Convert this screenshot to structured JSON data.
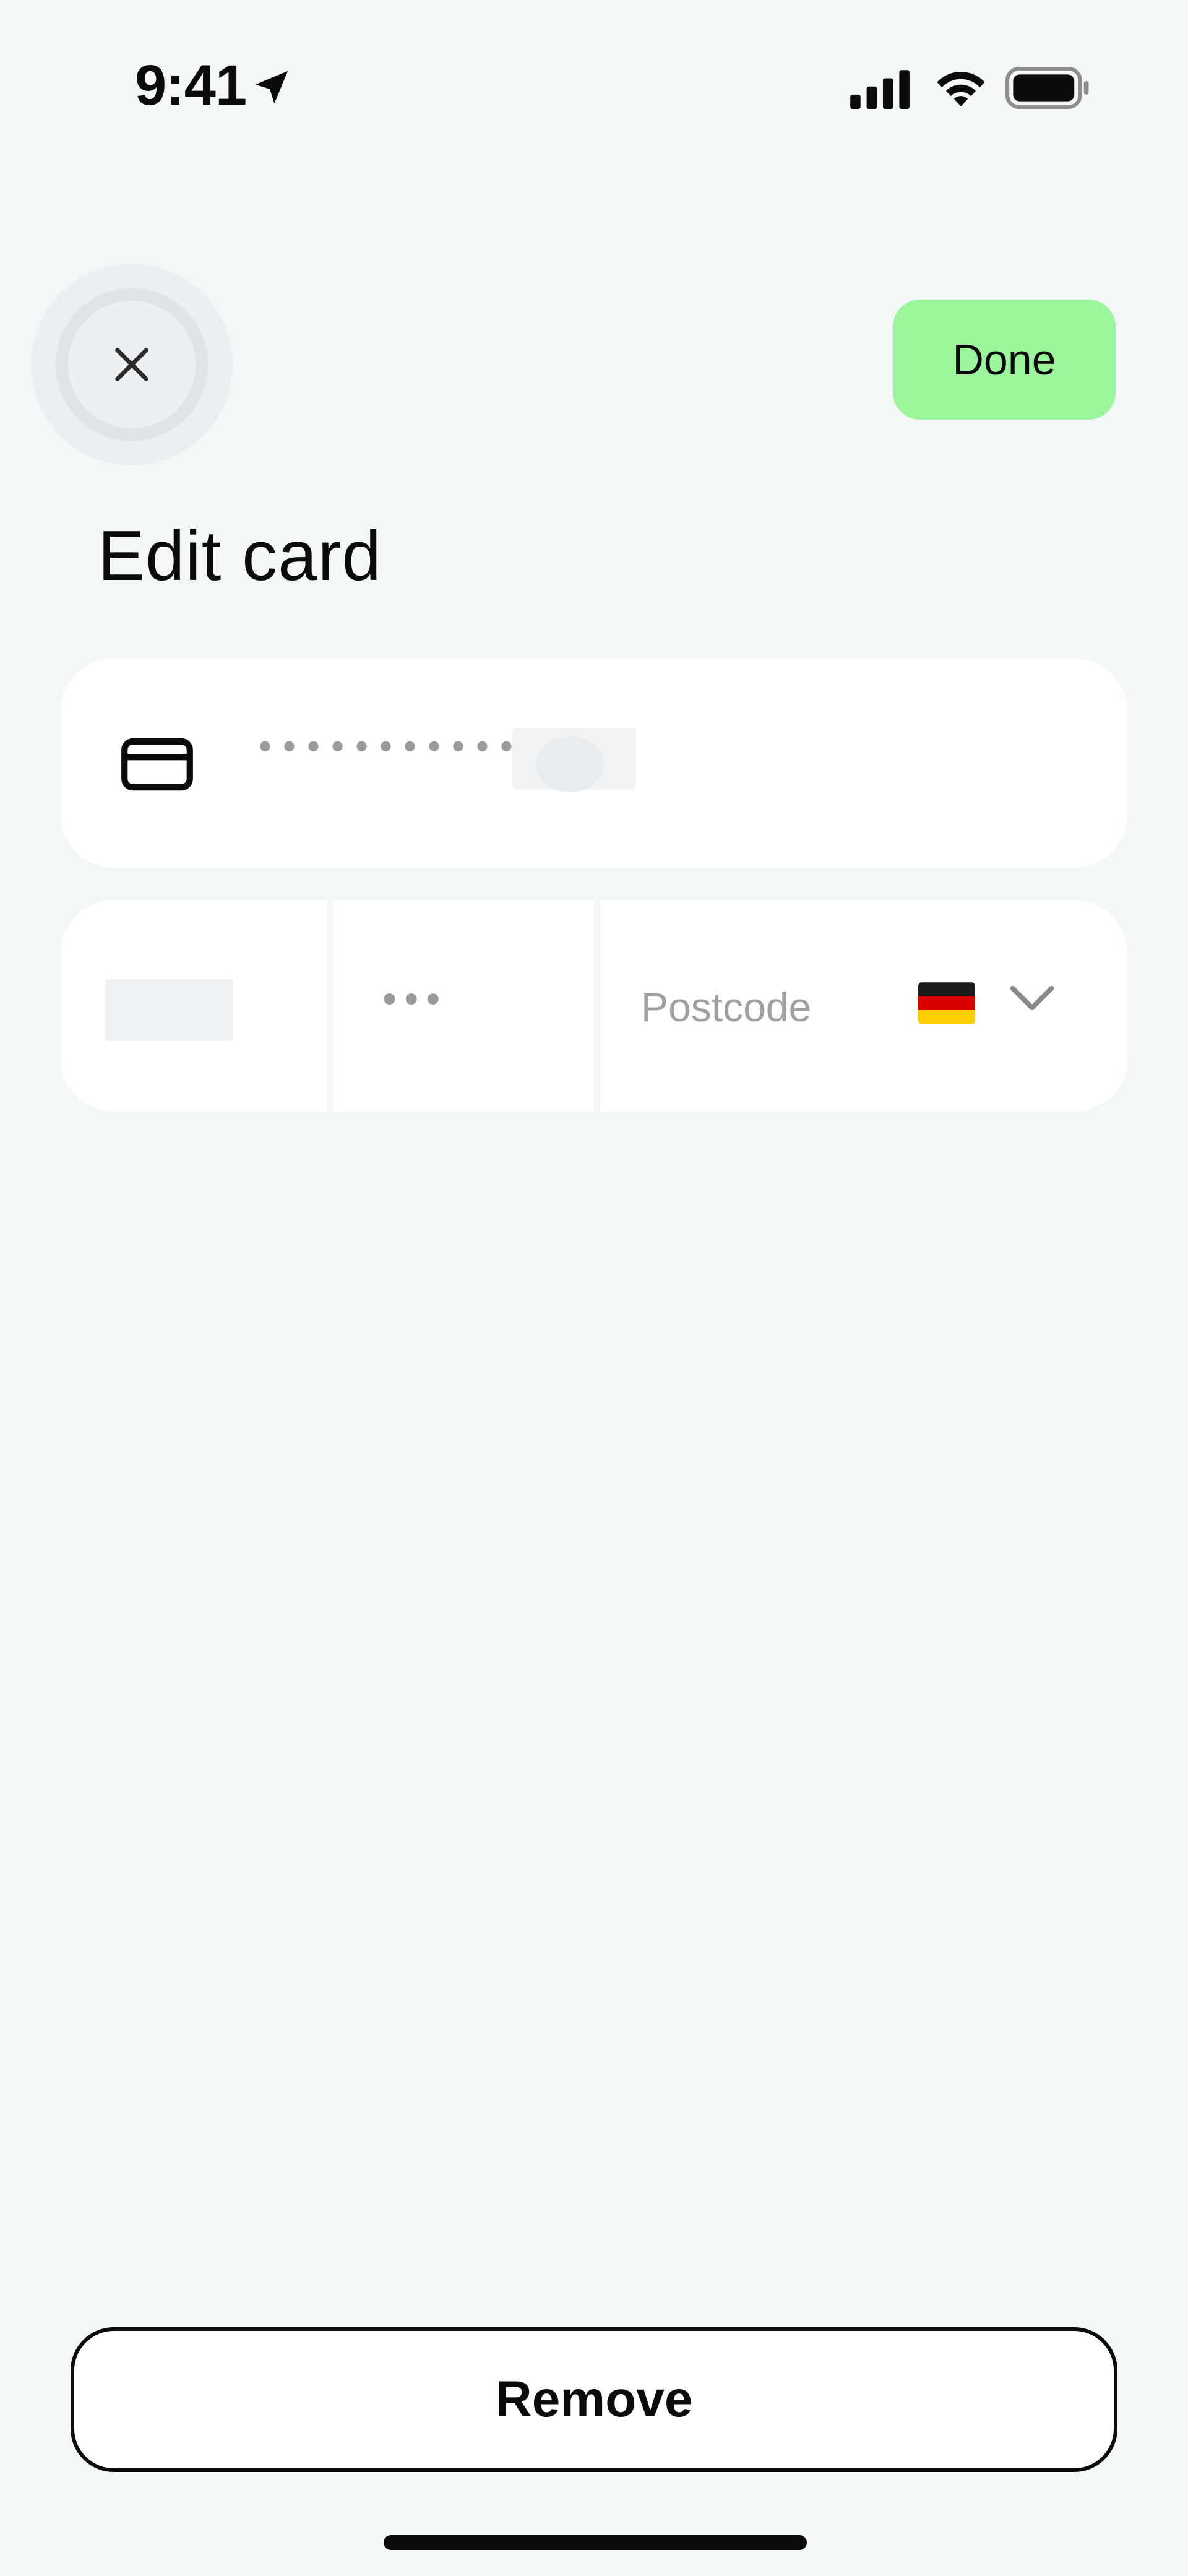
{
  "status_bar": {
    "time": "9:41",
    "location_icon": "location-arrow-icon",
    "signal_icon": "cellular-signal-icon",
    "wifi_icon": "wifi-icon",
    "battery_icon": "battery-full-icon"
  },
  "header": {
    "close_icon": "close-icon",
    "done_label": "Done",
    "done_color": "#9AF59B"
  },
  "title": "Edit card",
  "card_number": {
    "icon": "credit-card-icon",
    "masked_value": "••••••••••••"
  },
  "details": {
    "cvc_value": "•••",
    "postcode_placeholder": "Postcode",
    "country_flag_icon": "germany-flag-icon",
    "dropdown_icon": "chevron-down-icon"
  },
  "actions": {
    "remove_label": "Remove"
  },
  "colors": {
    "background": "#F3F7F8",
    "surface": "#FFFFFF",
    "text": "#0B0B0B",
    "muted": "#9A9A9A"
  }
}
